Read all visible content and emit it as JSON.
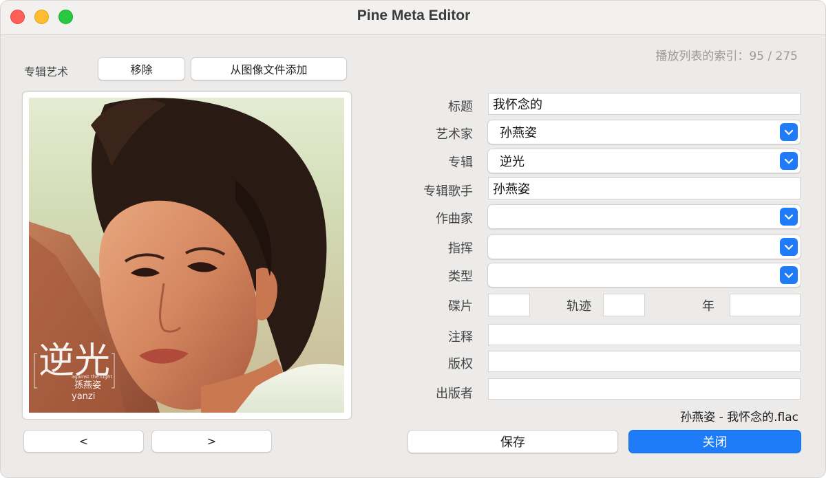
{
  "window": {
    "title": "Pine Meta Editor"
  },
  "playlist_index": "播放列表的索引：95 / 275",
  "artwork": {
    "label": "专辑艺术",
    "remove_label": "移除",
    "add_from_file_label": "从图像文件添加",
    "prev_label": "<",
    "next_label": ">",
    "cover": {
      "title_text": "逆光",
      "subtitle_text": "against the Light",
      "artist_text": "孫燕姿",
      "artist_latin": "yanzi"
    }
  },
  "fields": {
    "title": {
      "label": "标题",
      "value": "我怀念的"
    },
    "artist": {
      "label": "艺术家",
      "value": "孙燕姿"
    },
    "album": {
      "label": "专辑",
      "value": "逆光"
    },
    "album_artist": {
      "label": "专辑歌手",
      "value": "孙燕姿"
    },
    "composer": {
      "label": "作曲家",
      "value": ""
    },
    "conductor": {
      "label": "指挥",
      "value": ""
    },
    "genre": {
      "label": "类型",
      "value": ""
    },
    "disc": {
      "label": "碟片",
      "value": ""
    },
    "track": {
      "label": "轨迹",
      "value": ""
    },
    "year": {
      "label": "年",
      "value": ""
    },
    "comment": {
      "label": "注释",
      "value": ""
    },
    "copyright": {
      "label": "版权",
      "value": ""
    },
    "publisher": {
      "label": "出版者",
      "value": ""
    }
  },
  "filename": "孙燕姿 - 我怀念的.flac",
  "actions": {
    "save_label": "保存",
    "close_label": "关闭"
  },
  "colors": {
    "accent": "#1f7cf8",
    "close": "#fe5f57",
    "minimize": "#febc2e",
    "maximize": "#28c840"
  }
}
